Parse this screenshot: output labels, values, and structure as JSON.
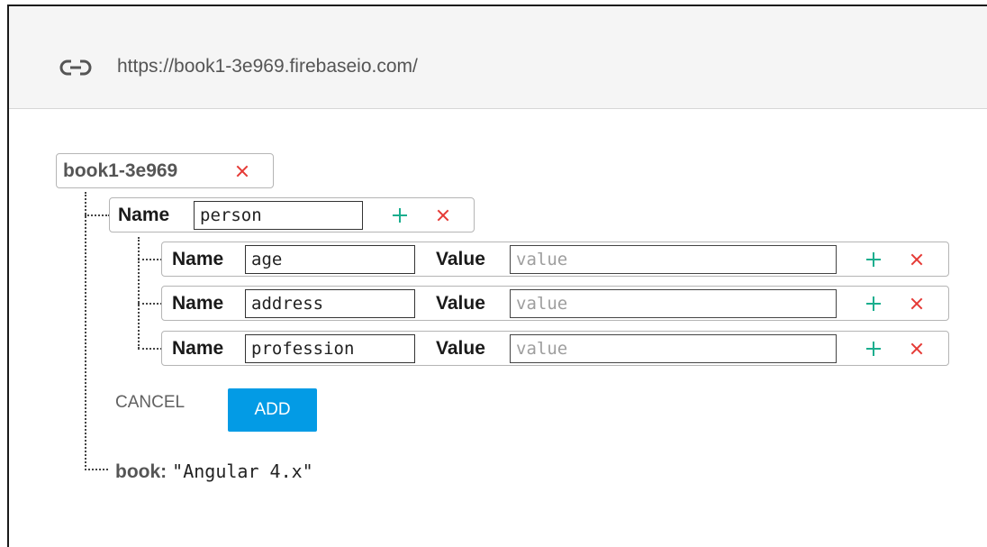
{
  "url": "https://book1-3e969.firebaseio.com/",
  "root": {
    "name": "book1-3e969"
  },
  "labels": {
    "name": "Name",
    "value": "Value"
  },
  "child": {
    "name_value": "person"
  },
  "grandchildren": [
    {
      "name_value": "age",
      "value_placeholder": "value"
    },
    {
      "name_value": "address",
      "value_placeholder": "value"
    },
    {
      "name_value": "profession",
      "value_placeholder": "value"
    }
  ],
  "actions": {
    "cancel": "CANCEL",
    "add": "ADD"
  },
  "leaf": {
    "key": "book:",
    "value": "\"Angular 4.x\""
  },
  "colors": {
    "accent_blue": "#039be5",
    "add_green": "#1aae8e",
    "remove_red": "#e53935"
  },
  "icons": {
    "url": "link-icon",
    "add": "plus-icon",
    "remove": "close-icon"
  }
}
